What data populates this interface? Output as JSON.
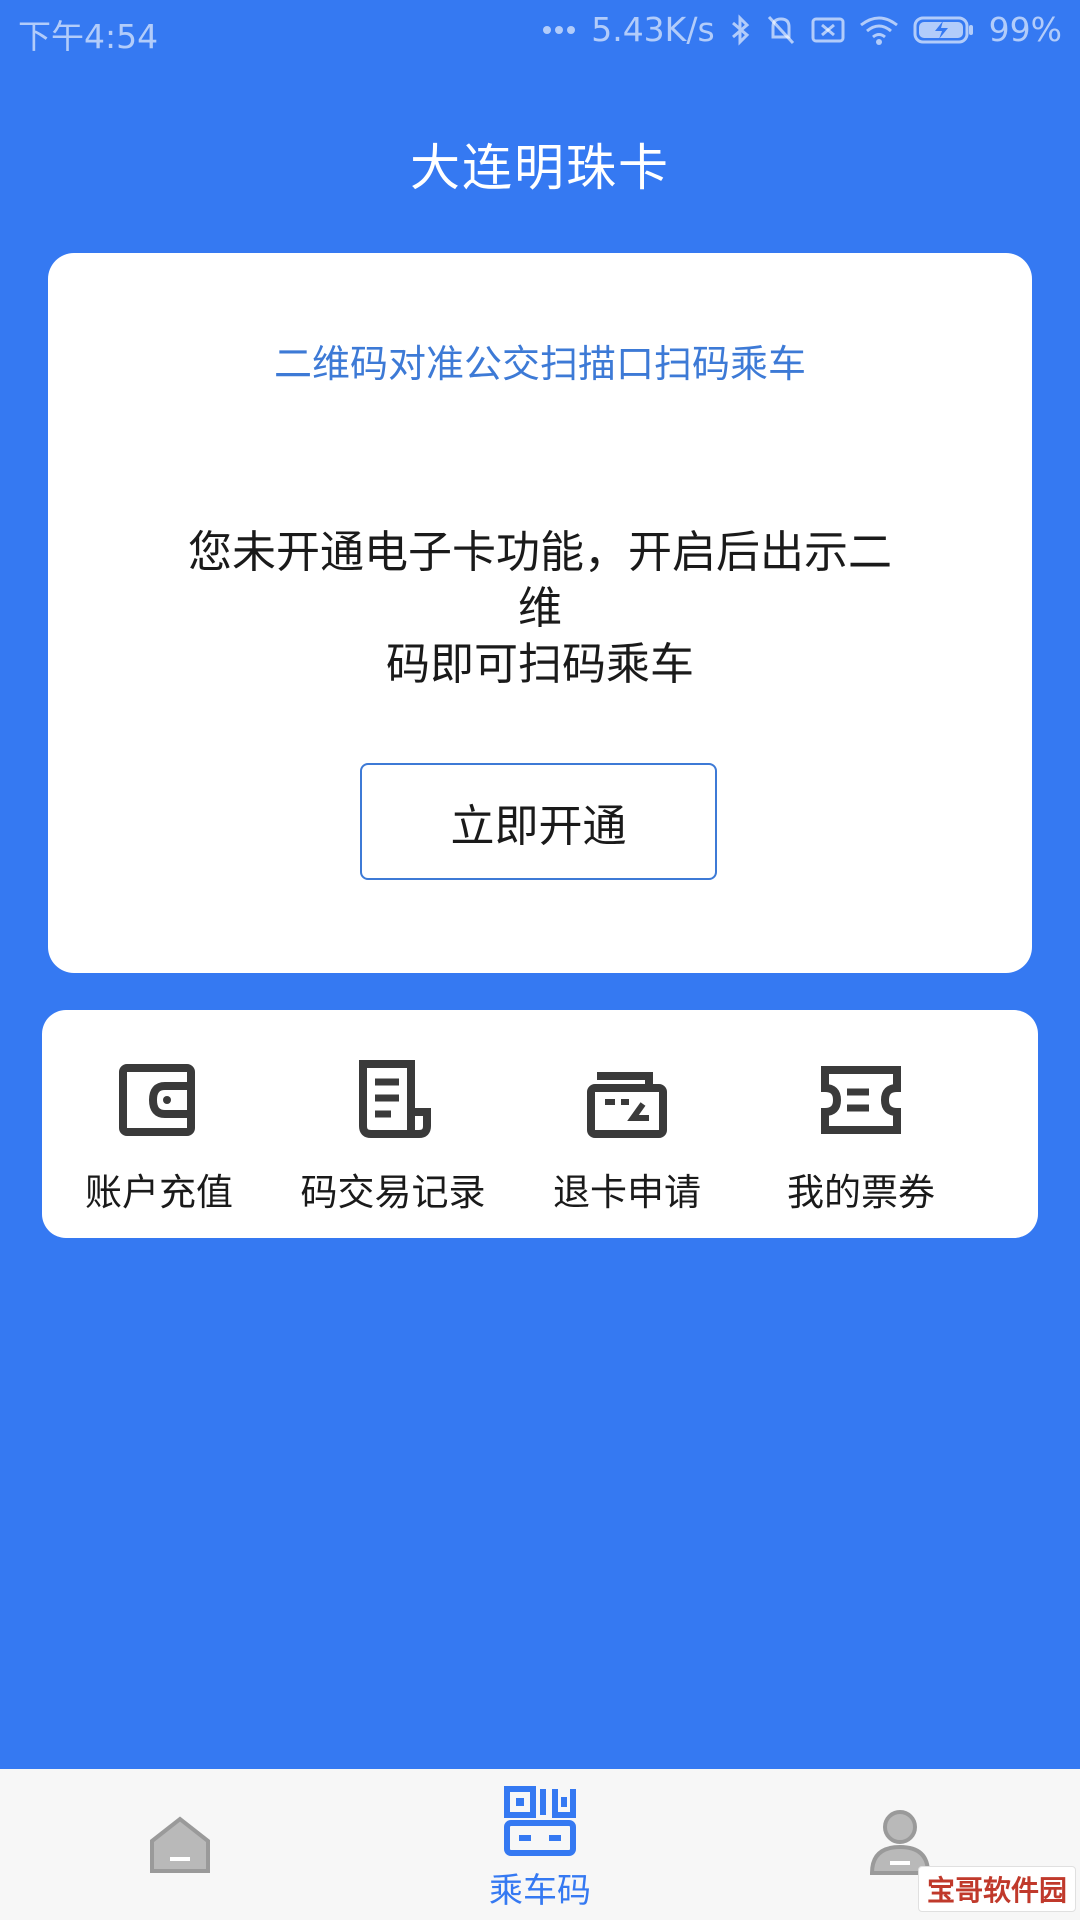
{
  "status_bar": {
    "time": "下午4:54",
    "net_speed": "5.43K/s",
    "battery": "99%"
  },
  "header": {
    "title": "大连明珠卡"
  },
  "qr_card": {
    "hint": "二维码对准公交扫描口扫码乘车",
    "notice_line1": "您未开通电子卡功能，开启后出示二维",
    "notice_line2": "码即可扫码乘车",
    "activate_label": "立即开通"
  },
  "functions": [
    {
      "label": "账户充值",
      "icon": "wallet-icon"
    },
    {
      "label": "码交易记录",
      "icon": "receipt-icon"
    },
    {
      "label": "退卡申请",
      "icon": "card-refund-icon"
    },
    {
      "label": "我的票券",
      "icon": "ticket-icon"
    }
  ],
  "bottom_nav": {
    "items": [
      {
        "label": "",
        "icon": "home-icon",
        "active": false
      },
      {
        "label": "乘车码",
        "icon": "qr-code-icon",
        "active": true
      },
      {
        "label": "",
        "icon": "user-icon",
        "active": false
      }
    ]
  },
  "watermark": "宝哥软件园",
  "colors": {
    "primary": "#3579f2",
    "accent_text": "#3d7ad6",
    "card": "#ffffff",
    "nav_bg": "#f7f7f7"
  }
}
